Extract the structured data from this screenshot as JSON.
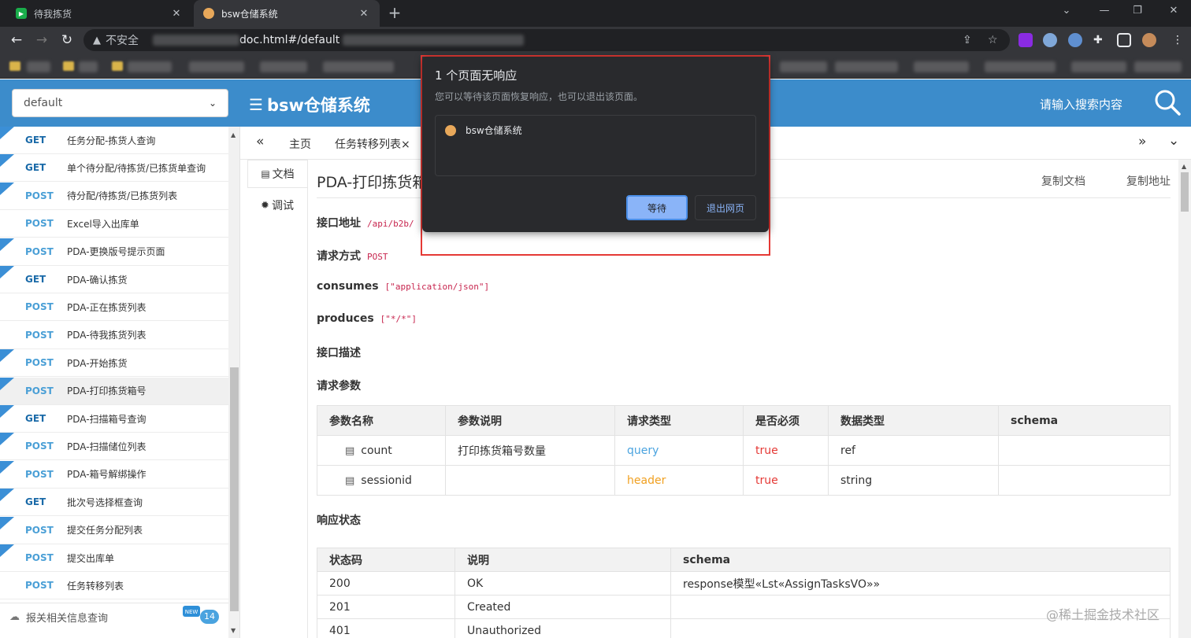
{
  "browser": {
    "tabs": [
      {
        "title": "待我拣货",
        "active": false
      },
      {
        "title": "bsw仓储系统",
        "active": true
      }
    ],
    "new_tab": "+",
    "address": {
      "security_label": "不安全",
      "url_visible": "doc.html#/default"
    }
  },
  "header": {
    "group_select": "default",
    "brand": "bsw仓储系统",
    "search_placeholder": "请输入搜索内容"
  },
  "sidebar": {
    "items": [
      {
        "method": "GET",
        "label": "任务分配-拣货人查询"
      },
      {
        "method": "GET",
        "label": "单个待分配/待拣货/已拣货单查询"
      },
      {
        "method": "POST",
        "label": "待分配/待拣货/已拣货列表"
      },
      {
        "method": "POST",
        "label": "Excel导入出库单"
      },
      {
        "method": "POST",
        "label": "PDA-更换版号提示页面"
      },
      {
        "method": "GET",
        "label": "PDA-确认拣货"
      },
      {
        "method": "POST",
        "label": "PDA-正在拣货列表"
      },
      {
        "method": "POST",
        "label": "PDA-待我拣货列表"
      },
      {
        "method": "POST",
        "label": "PDA-开始拣货"
      },
      {
        "method": "POST",
        "label": "PDA-打印拣货箱号"
      },
      {
        "method": "GET",
        "label": "PDA-扫描箱号查询"
      },
      {
        "method": "POST",
        "label": "PDA-扫描储位列表"
      },
      {
        "method": "POST",
        "label": "PDA-箱号解绑操作"
      },
      {
        "method": "GET",
        "label": "批次号选择框查询"
      },
      {
        "method": "POST",
        "label": "提交任务分配列表"
      },
      {
        "method": "POST",
        "label": "提交出库单"
      },
      {
        "method": "POST",
        "label": "任务转移列表"
      }
    ],
    "footer": {
      "label": "报关相关信息查询",
      "badge": "14"
    }
  },
  "tabs": {
    "home": "主页",
    "current": "任务转移列表×"
  },
  "subnav": {
    "doc": "文档",
    "debug": "调试"
  },
  "doc": {
    "title": "PDA-打印拣货箱",
    "copy_doc": "复制文档",
    "copy_addr": "复制地址",
    "api_addr_label": "接口地址",
    "api_addr": "/api/b2b/",
    "method_label": "请求方式",
    "method": "POST",
    "consumes_label": "consumes",
    "consumes": "[\"application/json\"]",
    "produces_label": "produces",
    "produces": "[\"*/*\"]",
    "desc_label": "接口描述",
    "params_label": "请求参数",
    "params_headers": [
      "参数名称",
      "参数说明",
      "请求类型",
      "是否必须",
      "数据类型",
      "schema"
    ],
    "params": [
      {
        "name": "count",
        "desc": "打印拣货箱号数量",
        "in": "query",
        "required": "true",
        "type": "ref",
        "schema": ""
      },
      {
        "name": "sessionid",
        "desc": "",
        "in": "header",
        "required": "true",
        "type": "string",
        "schema": ""
      }
    ],
    "resp_label": "响应状态",
    "resp_headers": [
      "状态码",
      "说明",
      "schema"
    ],
    "resp": [
      {
        "code": "200",
        "desc": "OK",
        "schema": "response模型«Lst«AssignTasksVO»»"
      },
      {
        "code": "201",
        "desc": "Created",
        "schema": ""
      },
      {
        "code": "401",
        "desc": "Unauthorized",
        "schema": ""
      }
    ]
  },
  "dialog": {
    "title": "1 个页面无响应",
    "subtitle": "您可以等待该页面恢复响应，也可以退出该页面。",
    "page": "bsw仓储系统",
    "wait": "等待",
    "exit": "退出网页"
  },
  "watermark": "@稀土掘金技术社区",
  "colors": {
    "header_bg": "#3c8ccb",
    "get": "#1a6aa8",
    "post": "#4a9fd6",
    "highlight_frame": "#e53935"
  }
}
